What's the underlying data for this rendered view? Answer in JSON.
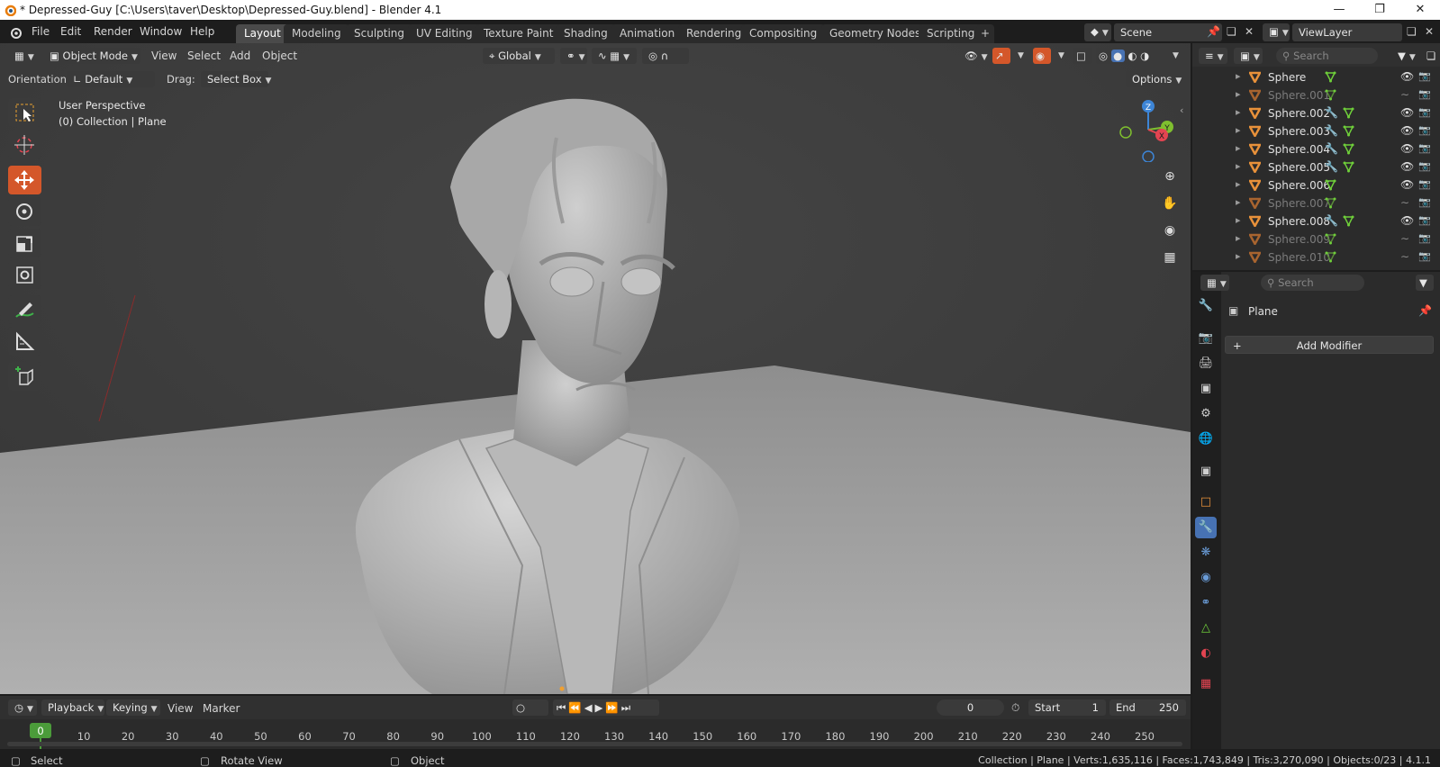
{
  "window": {
    "title": "* Depressed-Guy [C:\\Users\\taver\\Desktop\\Depressed-Guy.blend] - Blender 4.1",
    "minimize_icon": "minimize-icon",
    "maximize_icon": "maximize-icon",
    "close_icon": "close-icon"
  },
  "menubar": {
    "items": [
      "File",
      "Edit",
      "Render",
      "Window",
      "Help"
    ],
    "workspaces": [
      "Layout",
      "Modeling",
      "Sculpting",
      "UV Editing",
      "Texture Paint",
      "Shading",
      "Animation",
      "Rendering",
      "Compositing",
      "Geometry Nodes",
      "Scripting"
    ],
    "active_workspace": "Layout",
    "add_workspace": "+",
    "scene_name": "Scene",
    "view_layer": "ViewLayer"
  },
  "viewport_header": {
    "mode": "Object Mode",
    "menus": [
      "View",
      "Select",
      "Add",
      "Object"
    ],
    "transform_orientation": "Global",
    "orientation_label": "Orientation:",
    "orientation_value": "Default",
    "drag_label": "Drag:",
    "drag_value": "Select Box",
    "options_label": "Options"
  },
  "viewport": {
    "perspective": "User Perspective",
    "collection_info": "(0) Collection | Plane",
    "gizmo_axes": [
      "Z",
      "Y",
      "X"
    ]
  },
  "outliner": {
    "search_placeholder": "Search",
    "rows": [
      {
        "name": "Sphere",
        "dim": false,
        "modifier": false,
        "visible": true
      },
      {
        "name": "Sphere.001",
        "dim": true,
        "modifier": false,
        "visible": false
      },
      {
        "name": "Sphere.002",
        "dim": false,
        "modifier": true,
        "visible": true
      },
      {
        "name": "Sphere.003",
        "dim": false,
        "modifier": true,
        "visible": true
      },
      {
        "name": "Sphere.004",
        "dim": false,
        "modifier": true,
        "visible": true
      },
      {
        "name": "Sphere.005",
        "dim": false,
        "modifier": true,
        "visible": true
      },
      {
        "name": "Sphere.006",
        "dim": false,
        "modifier": false,
        "visible": true
      },
      {
        "name": "Sphere.007",
        "dim": true,
        "modifier": false,
        "visible": false
      },
      {
        "name": "Sphere.008",
        "dim": false,
        "modifier": true,
        "visible": true
      },
      {
        "name": "Sphere.009",
        "dim": true,
        "modifier": false,
        "visible": false
      },
      {
        "name": "Sphere.010",
        "dim": true,
        "modifier": false,
        "visible": false
      }
    ]
  },
  "properties": {
    "search_placeholder": "Search",
    "object_name": "Plane",
    "add_modifier": "Add Modifier",
    "tabs": [
      "tool-icon",
      "render-icon",
      "output-icon",
      "view-layer-icon",
      "scene-icon",
      "world-icon",
      "collection-icon",
      "object-icon",
      "modifier-icon",
      "particles-icon",
      "physics-icon",
      "constraints-icon",
      "data-icon",
      "material-icon",
      "texture-icon"
    ],
    "active_tab": "modifier-icon"
  },
  "timeline": {
    "menus": [
      "Playback",
      "Keying",
      "View",
      "Marker"
    ],
    "current_frame": "0",
    "start_label": "Start",
    "start_value": "1",
    "end_label": "End",
    "end_value": "250",
    "ticks": [
      "0",
      "10",
      "20",
      "30",
      "40",
      "50",
      "60",
      "70",
      "80",
      "90",
      "100",
      "110",
      "120",
      "130",
      "140",
      "150",
      "160",
      "170",
      "180",
      "190",
      "200",
      "210",
      "220",
      "230",
      "240",
      "250"
    ]
  },
  "statusbar": {
    "select": "Select",
    "rotate_view": "Rotate View",
    "object": "Object",
    "stats": "Collection | Plane | Verts:1,635,116 | Faces:1,743,849 | Tris:3,270,090 | Objects:0/23 | 4.1.1"
  },
  "colors": {
    "accent_orange": "#d4572a",
    "accent_blue": "#4772b3",
    "axis_x": "#e44451",
    "axis_y": "#7fbf2f",
    "axis_z": "#3d85d6"
  }
}
